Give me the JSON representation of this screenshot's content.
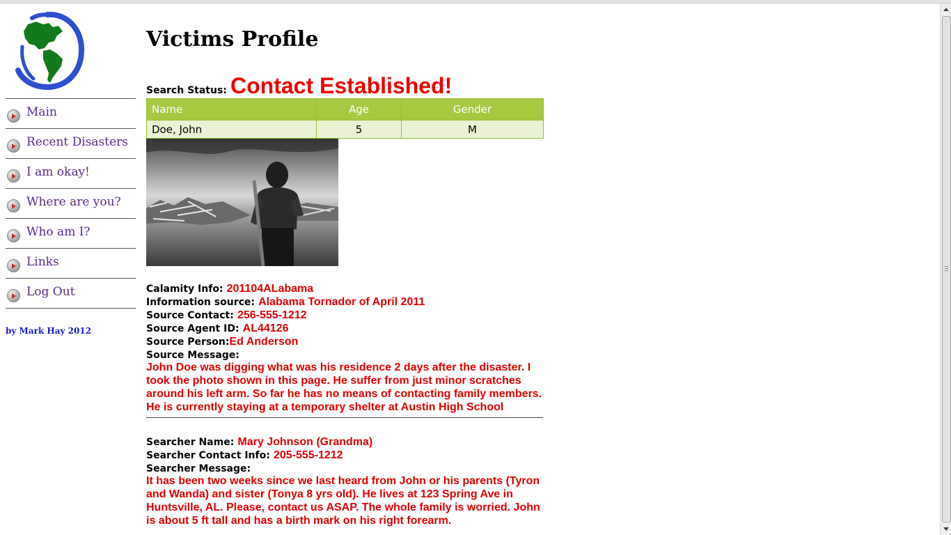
{
  "page": {
    "title": "Victims Profile"
  },
  "sidebar": {
    "logo_icon": "globe-americas-icon",
    "items": [
      {
        "label": "Main"
      },
      {
        "label": "Recent Disasters"
      },
      {
        "label": "I am okay!"
      },
      {
        "label": "Where are you?"
      },
      {
        "label": "Who am I?"
      },
      {
        "label": "Links"
      },
      {
        "label": "Log Out"
      }
    ],
    "byline": "by Mark Hay 2012"
  },
  "status": {
    "label": "Search Status:",
    "value": "Contact Established!"
  },
  "victim_table": {
    "headers": [
      "Name",
      "Age",
      "Gender"
    ],
    "rows": [
      [
        "Doe, John",
        "5",
        "M"
      ]
    ]
  },
  "source": {
    "calamity_label": "Calamity Info:",
    "calamity_value": "201104ALabama",
    "info_source_label": "Information source:",
    "info_source_value": "Alabama Tornador of April 2011",
    "contact_label": "Source Contact:",
    "contact_value": "256-555-1212",
    "agent_label": "Source Agent ID:",
    "agent_value": "AL44126",
    "person_label": "Source Person:",
    "person_value": "Ed Anderson",
    "message_label": "Source Message:",
    "message_value": "John Doe was digging what was his residence 2 days after the disaster. I took the photo shown in this page. He suffer from just minor scratches around his left arm. So far he has no means of contacting family members. He is currently staying at a temporary shelter at Austin High School"
  },
  "searcher": {
    "name_label": "Searcher Name:",
    "name_value": "Mary Johnson (Grandma)",
    "contact_label": "Searcher Contact Info:",
    "contact_value": "205-555-1212",
    "message_label": "Searcher Message:",
    "message_value": "It has been two weeks since we last heard from John or his parents (Tyron and Wanda) and sister (Tonya 8 yrs old). He lives at 123 Spring Ave in Huntsville, AL. Please, contact us ASAP. The whole family is worried. John is about 5 ft tall and has a birth mark on his right forearm."
  },
  "colors": {
    "status_red": "#ee0000",
    "table_header_green": "#a6c941",
    "table_row_green": "#eaf2d3",
    "nav_link_purple": "#5a2a8a",
    "byline_blue": "#1a1acc"
  }
}
